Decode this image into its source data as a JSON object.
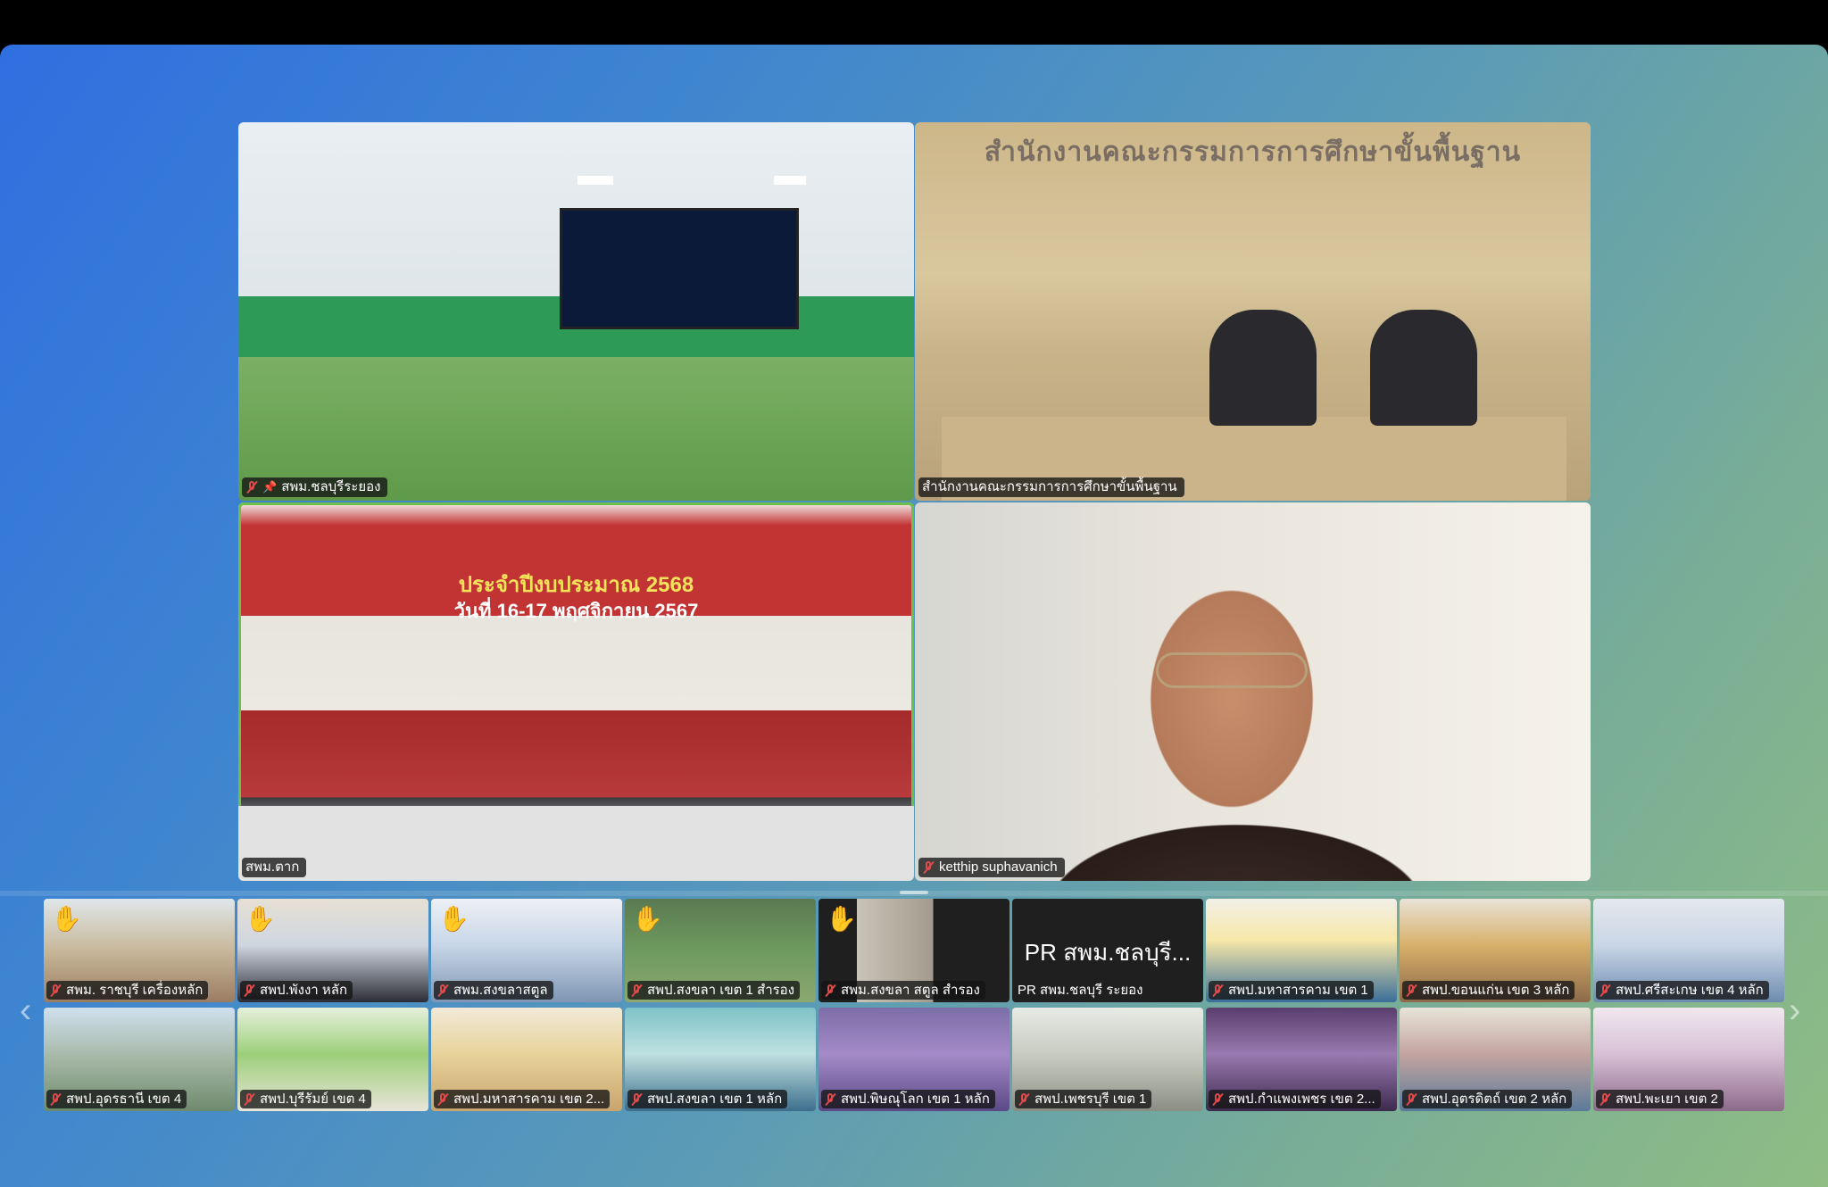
{
  "main_tiles": [
    {
      "name": "สพม.ชลบุรีระยอง",
      "muted": true,
      "pinned": true
    },
    {
      "name": "สำนักงานคณะกรรมการการศึกษาขั้นพื้นฐาน",
      "wall_text": "สำนักงานคณะกรรมการการศึกษาขั้นพื้นฐาน"
    },
    {
      "name": "สพม.ตาก",
      "banner_line1": "ประจำปีงบประมาณ 2568",
      "banner_line2": "วันที่ 16-17 พฤศจิกายน 2567",
      "active_speaker": true
    },
    {
      "name": "ketthip suphavanich",
      "muted": true
    }
  ],
  "thumbnails_row1": [
    {
      "name": "สพม. ราชบุรี เครื่องหลัก",
      "hand_raised": true
    },
    {
      "name": "สพป.พังงา หลัก",
      "hand_raised": true
    },
    {
      "name": "สพม.สงขลาสตูล",
      "hand_raised": true
    },
    {
      "name": "สพป.สงขลา เขต 1 สำรอง",
      "hand_raised": true
    },
    {
      "name": "สพม.สงขลา สตูล สำรอง",
      "hand_raised": true
    },
    {
      "name": "PR สพม.ชลบุรี ระยอง",
      "big_label": "PR สพม.ชลบุรี..."
    },
    {
      "name": "สพป.มหาสารคาม เขต 1"
    },
    {
      "name": "สพป.ขอนแก่น เขต 3 หลัก"
    },
    {
      "name": "สพป.ศรีสะเกษ เขต 4 หลัก"
    }
  ],
  "thumbnails_row2": [
    {
      "name": "สพป.อุดรธานี เขต 4"
    },
    {
      "name": "สพป.บุรีรัมย์ เขต 4"
    },
    {
      "name": "สพป.มหาสารคาม เขต 2..."
    },
    {
      "name": "สพป.สงขลา เขต 1 หลัก"
    },
    {
      "name": "สพป.พิษณุโลก เขต 1 หลัก"
    },
    {
      "name": "สพป.เพชรบุรี เขต 1"
    },
    {
      "name": "สพป.กำแพงเพชร เขต 2..."
    },
    {
      "name": "สพป.อุตรดิตถ์ เขต 2 หลัก"
    },
    {
      "name": "สพป.พะเยา เขต 2"
    }
  ],
  "nav": {
    "prev_icon": "chevron-left-icon",
    "next_icon": "chevron-right-icon"
  },
  "colors": {
    "active_border": "#6cc04a",
    "muted_icon": "#e04a4a"
  }
}
